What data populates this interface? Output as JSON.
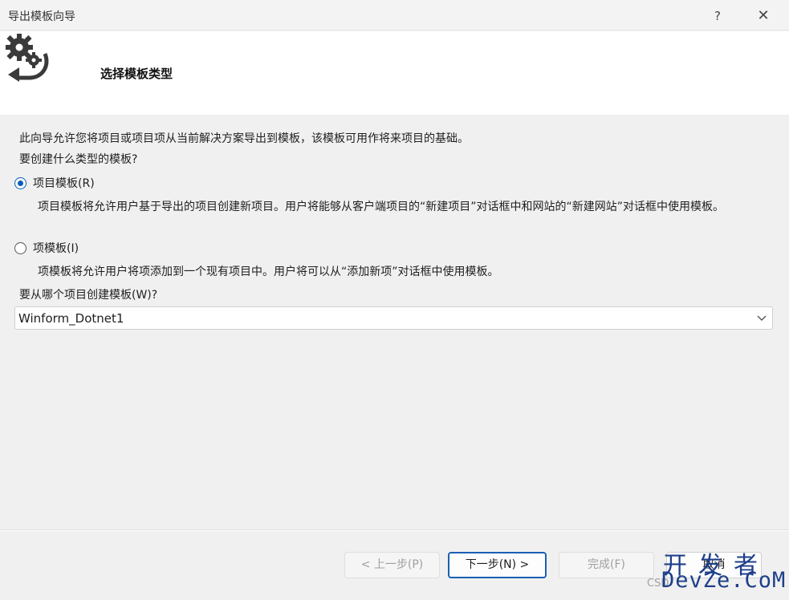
{
  "window": {
    "title": "导出模板向导",
    "help_label": "?",
    "close_label": "✕"
  },
  "header": {
    "heading": "选择模板类型",
    "icon": "gear-export-icon"
  },
  "main": {
    "intro": "此向导允许您将项目或项目项从当前解决方案导出到模板，该模板可用作将来项目的基础。",
    "question_type": "要创建什么类型的模板?",
    "options": [
      {
        "label": "项目模板(R)",
        "selected": true,
        "description": "项目模板将允许用户基于导出的项目创建新项目。用户将能够从客户端项目的“新建项目”对话框中和网站的“新建网站”对话框中使用模板。"
      },
      {
        "label": "项模板(I)",
        "selected": false,
        "description": "项模板将允许用户将项添加到一个现有项目中。用户将可以从“添加新项”对话框中使用模板。"
      }
    ],
    "question_project": "要从哪个项目创建模板(W)?",
    "project_select": {
      "value": "Winform_Dotnet1"
    }
  },
  "footer": {
    "prev_label": "< 上一步(P)",
    "next_label": "下一步(N) >",
    "finish_label": "完成(F)",
    "cancel_label": "取消"
  },
  "watermark": {
    "line1": "开发者",
    "line2": "DevZe.CoM",
    "small": "CSD"
  },
  "colors": {
    "accent": "#0a5fb4",
    "background": "#f0f0f0",
    "header_bg": "#ffffff"
  }
}
